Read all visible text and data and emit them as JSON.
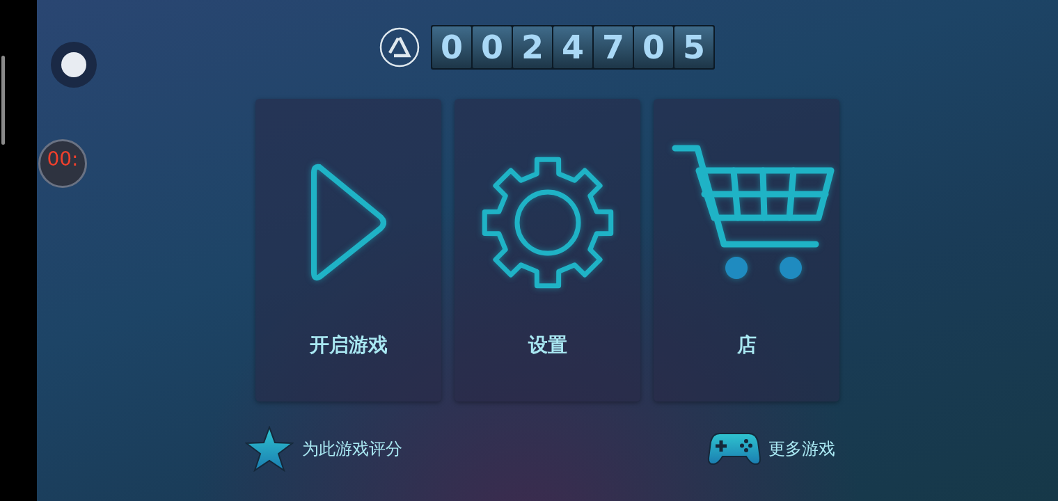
{
  "timer": {
    "text": "00:"
  },
  "counter": {
    "digits": [
      "0",
      "0",
      "2",
      "4",
      "7",
      "0",
      "5"
    ]
  },
  "menu": [
    {
      "kind": "play",
      "label": "开启游戏"
    },
    {
      "kind": "settings",
      "label": "设置"
    },
    {
      "kind": "cart",
      "label": "店"
    }
  ],
  "links": [
    {
      "kind": "star",
      "label": "为此游戏评分"
    },
    {
      "kind": "gamepad",
      "label": "更多游戏"
    }
  ]
}
